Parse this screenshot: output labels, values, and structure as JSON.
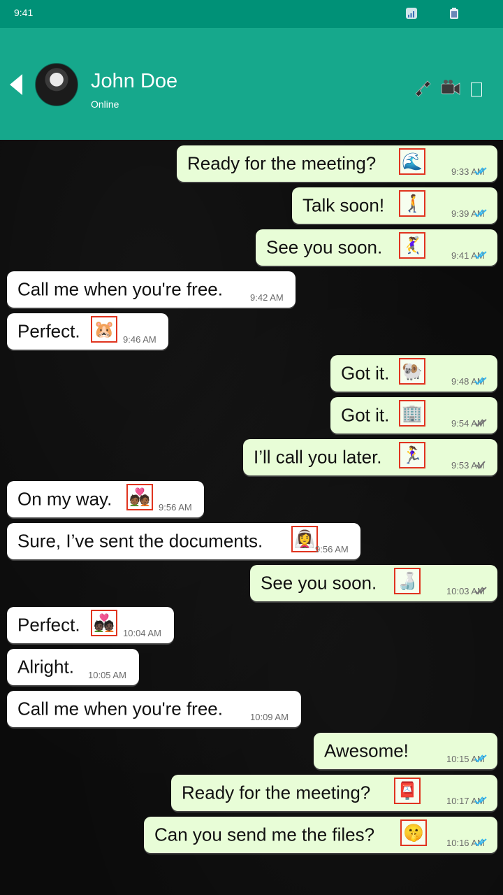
{
  "status_bar": {
    "time": "9:41",
    "signal_icon": "signal-icon",
    "battery_icon": "battery-icon"
  },
  "header": {
    "contact_name": "John Doe",
    "presence": "Online",
    "icons": [
      "back-arrow-icon",
      "phone-icon",
      "video-camera-icon",
      "menu-icon"
    ]
  },
  "colors": {
    "status_bar": "#009177",
    "header": "#16a88c",
    "outgoing_bubble": "#e8fdd7",
    "incoming_bubble": "#ffffff",
    "chat_background": "#0b0b0b",
    "read_tick": "#34b7f1",
    "sent_tick": "#777777"
  },
  "messages": [
    {
      "dir": "out",
      "text": "Ready for the meeting?",
      "emoji": "🌊",
      "time": "9:33 AM",
      "status": "read"
    },
    {
      "dir": "out",
      "text": "Talk soon!",
      "emoji": "🚶‍➡️",
      "time": "9:39 AM",
      "status": "read"
    },
    {
      "dir": "out",
      "text": "See you soon.",
      "emoji": "🤾‍♀️",
      "time": "9:41 AM",
      "status": "read"
    },
    {
      "dir": "in",
      "text": "Call me when you're free.",
      "emoji": "",
      "time": "9:42 AM"
    },
    {
      "dir": "in",
      "text": "Perfect.",
      "emoji": "🐹",
      "time": "9:46 AM"
    },
    {
      "dir": "out",
      "text": "Got it.",
      "emoji": "🐏",
      "time": "9:48 AM",
      "status": "read"
    },
    {
      "dir": "out",
      "text": "Got it.",
      "emoji": "🏢",
      "time": "9:54 AM",
      "status": "delivered"
    },
    {
      "dir": "out",
      "text": "I’ll call you later.",
      "emoji": "🏃‍♀️",
      "time": "9:53 AM",
      "status": "sent"
    },
    {
      "dir": "in",
      "text": "On my way.",
      "emoji": "💑🏾",
      "time": "9:56 AM"
    },
    {
      "dir": "in",
      "text": "Sure, I’ve sent the documents.",
      "emoji": "👰‍♀️",
      "time": "9:56 AM"
    },
    {
      "dir": "out",
      "text": "See you soon.",
      "emoji": "🍶",
      "time": "10:03 AM",
      "status": "delivered"
    },
    {
      "dir": "in",
      "text": "Perfect.",
      "emoji": "💑🏿",
      "time": "10:04 AM"
    },
    {
      "dir": "in",
      "text": "Alright.",
      "emoji": "",
      "time": "10:05 AM"
    },
    {
      "dir": "in",
      "text": "Call me when you're free.",
      "emoji": "",
      "time": "10:09 AM"
    },
    {
      "dir": "out",
      "text": "Awesome!",
      "emoji": "",
      "time": "10:15 AM",
      "status": "read"
    },
    {
      "dir": "out",
      "text": "Ready for the meeting?",
      "emoji": "📮",
      "time": "10:17 AM",
      "status": "read"
    },
    {
      "dir": "out",
      "text": "Can you send me the files?",
      "emoji": "🤫",
      "time": "10:16 AM",
      "status": "read"
    }
  ]
}
